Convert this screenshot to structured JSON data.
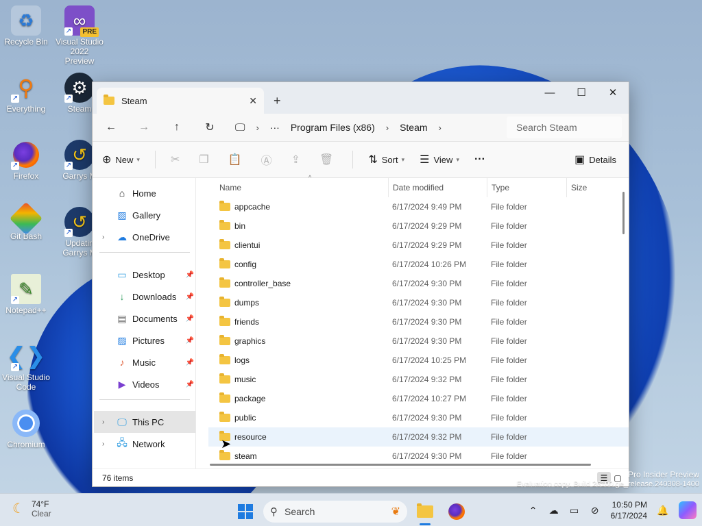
{
  "desktop": {
    "icons": [
      {
        "label": "Recycle Bin",
        "icon": "recycle-bin-icon"
      },
      {
        "label": "Visual Studio 2022 Preview",
        "icon": "visual-studio-icon",
        "badge": "PRE"
      },
      {
        "label": "Everything",
        "icon": "everything-search-icon"
      },
      {
        "label": "Steam",
        "icon": "steam-icon"
      },
      {
        "label": "Firefox",
        "icon": "firefox-icon"
      },
      {
        "label": "Garrys M",
        "icon": "garrys-mod-icon"
      },
      {
        "label": "Git Bash",
        "icon": "git-bash-icon"
      },
      {
        "label": "Updatin Garrys M",
        "icon": "garrys-mod-update-icon"
      },
      {
        "label": "Notepad++",
        "icon": "notepad-plus-plus-icon"
      },
      {
        "label": "Visual Studio Code",
        "icon": "vscode-icon"
      },
      {
        "label": "Chromium",
        "icon": "chromium-icon"
      }
    ],
    "watermark": {
      "line1": "Pro Insider Preview",
      "line2": "Evaluation copy. Build 26100.ge_release.240308-1400"
    }
  },
  "explorer": {
    "tab_title": "Steam",
    "window_controls": {
      "minimize": "—",
      "maximize": "☐",
      "close": "✕"
    },
    "breadcrumb": {
      "more": "···",
      "items": [
        "Program Files (x86)",
        "Steam"
      ]
    },
    "search_placeholder": "Search Steam",
    "toolbar": {
      "new_label": "New",
      "sort_label": "Sort",
      "view_label": "View",
      "more_label": "···",
      "details_label": "Details"
    },
    "sidebar": {
      "group1": [
        {
          "label": "Home",
          "icon": "home-icon",
          "expandable": false
        },
        {
          "label": "Gallery",
          "icon": "gallery-icon",
          "expandable": false
        },
        {
          "label": "OneDrive",
          "icon": "onedrive-icon",
          "expandable": true
        }
      ],
      "pinned": [
        {
          "label": "Desktop",
          "icon": "desktop-folder-icon"
        },
        {
          "label": "Downloads",
          "icon": "downloads-icon"
        },
        {
          "label": "Documents",
          "icon": "documents-icon"
        },
        {
          "label": "Pictures",
          "icon": "pictures-icon"
        },
        {
          "label": "Music",
          "icon": "music-icon"
        },
        {
          "label": "Videos",
          "icon": "videos-icon"
        }
      ],
      "group3": [
        {
          "label": "This PC",
          "icon": "this-pc-icon",
          "selected": true
        },
        {
          "label": "Network",
          "icon": "network-icon"
        }
      ]
    },
    "columns": {
      "name": "Name",
      "date": "Date modified",
      "type": "Type",
      "size": "Size"
    },
    "files": [
      {
        "name": "appcache",
        "date": "6/17/2024 9:49 PM",
        "type": "File folder"
      },
      {
        "name": "bin",
        "date": "6/17/2024 9:29 PM",
        "type": "File folder"
      },
      {
        "name": "clientui",
        "date": "6/17/2024 9:29 PM",
        "type": "File folder"
      },
      {
        "name": "config",
        "date": "6/17/2024 10:26 PM",
        "type": "File folder"
      },
      {
        "name": "controller_base",
        "date": "6/17/2024 9:30 PM",
        "type": "File folder"
      },
      {
        "name": "dumps",
        "date": "6/17/2024 9:30 PM",
        "type": "File folder"
      },
      {
        "name": "friends",
        "date": "6/17/2024 9:30 PM",
        "type": "File folder"
      },
      {
        "name": "graphics",
        "date": "6/17/2024 9:30 PM",
        "type": "File folder"
      },
      {
        "name": "logs",
        "date": "6/17/2024 10:25 PM",
        "type": "File folder"
      },
      {
        "name": "music",
        "date": "6/17/2024 9:32 PM",
        "type": "File folder"
      },
      {
        "name": "package",
        "date": "6/17/2024 10:27 PM",
        "type": "File folder"
      },
      {
        "name": "public",
        "date": "6/17/2024 9:30 PM",
        "type": "File folder"
      },
      {
        "name": "resource",
        "date": "6/17/2024 9:32 PM",
        "type": "File folder",
        "hover": true
      },
      {
        "name": "steam",
        "date": "6/17/2024 9:30 PM",
        "type": "File folder"
      }
    ],
    "status": {
      "item_count": "76 items"
    }
  },
  "taskbar": {
    "weather": {
      "temp": "74°F",
      "condition": "Clear"
    },
    "search_label": "Search",
    "clock": {
      "time": "10:50 PM",
      "date": "6/17/2024"
    },
    "accent": "#1e7be0"
  }
}
